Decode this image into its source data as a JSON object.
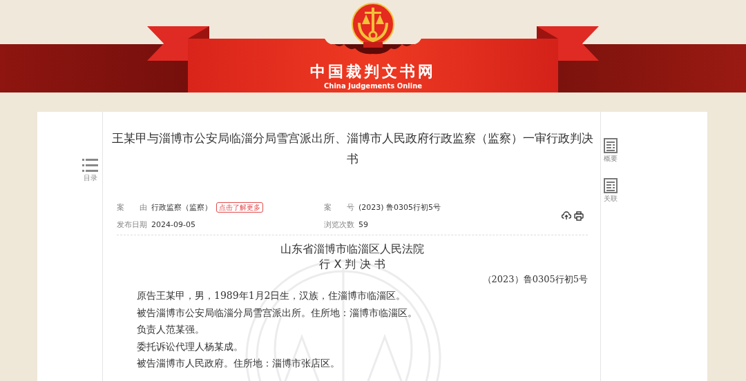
{
  "site": {
    "title": "中国裁判文书网",
    "subtitle": "China Judgements Online"
  },
  "left_tools": [
    {
      "label": "目录"
    }
  ],
  "right_tools": [
    {
      "label": "概要"
    },
    {
      "label": "关联"
    }
  ],
  "document": {
    "title": "王某甲与淄博市公安局临淄分局雪宫派出所、淄博市人民政府行政监察（监察）一审行政判决书",
    "meta": [
      {
        "label": "案　　由",
        "value": "行政监察（监察）",
        "badge": "点击了解更多"
      },
      {
        "label": "案　　号",
        "value": "(2023) 鲁0305行初5号"
      },
      {
        "label": "发布日期",
        "value": "2024-09-05"
      },
      {
        "label": "浏览次数",
        "value": "59"
      }
    ],
    "court": "山东省淄博市临淄区人民法院",
    "doc_type": "行 X 判 决 书",
    "case_number": "（2023）鲁0305行初5号",
    "paragraphs": [
      "原告王某甲，男，1989年1月2日生，汉族，住淄博市临淄区。",
      "被告淄博市公安局临淄分局雪宫派出所。住所地：淄博市临淄区。",
      "负责人范某强。",
      "委托诉讼代理人杨某成。",
      "被告淄博市人民政府。住所地：淄博市张店区。"
    ]
  }
}
